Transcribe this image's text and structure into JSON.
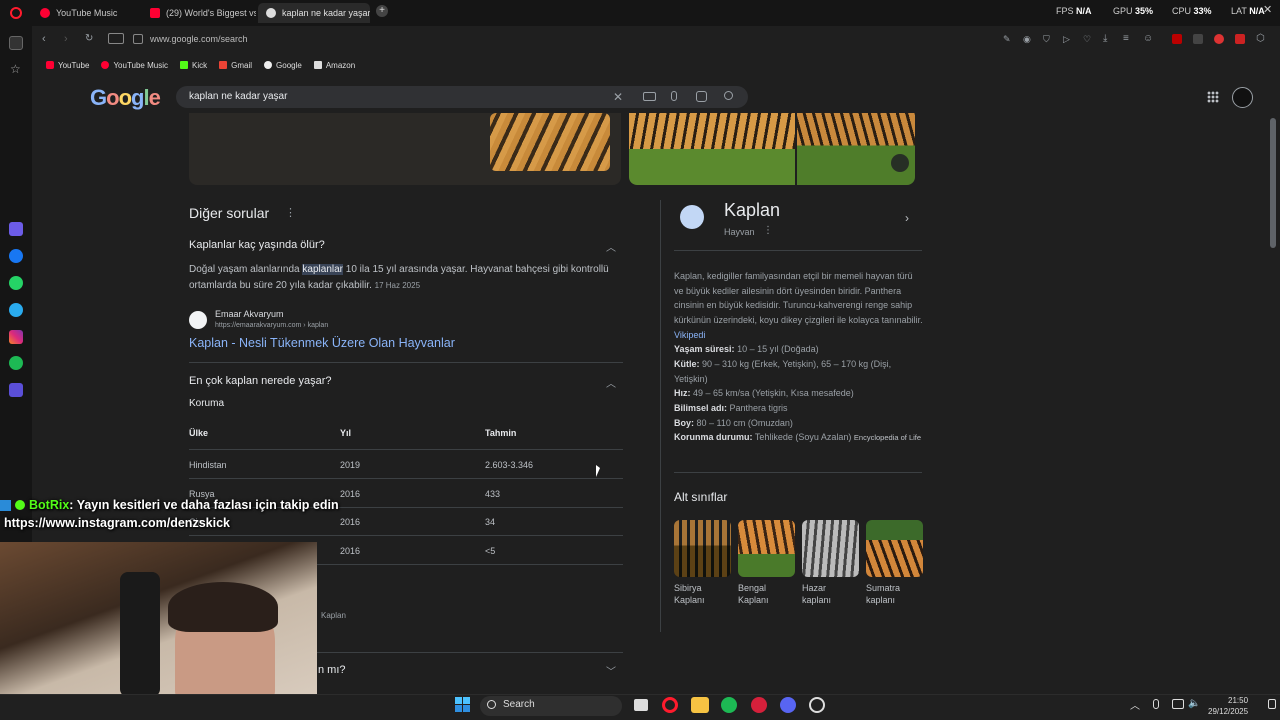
{
  "browser": {
    "tabs": [
      {
        "label": "YouTube Music"
      },
      {
        "label": "(29) World's Biggest vs Sm"
      },
      {
        "label": "kaplan ne kadar yaşar - Go"
      }
    ],
    "url": "www.google.com/search",
    "bookmarks": [
      "YouTube",
      "YouTube Music",
      "Kick",
      "Gmail",
      "Google",
      "Amazon"
    ],
    "stats": {
      "fps_label": "FPS",
      "fps_value": "N/A",
      "gpu_label": "GPU",
      "gpu_value": "35%",
      "cpu_label": "CPU",
      "cpu_value": "33%",
      "lat_label": "LAT",
      "lat_value": "N/A"
    }
  },
  "google": {
    "logo": "Google",
    "query": "kaplan ne kadar yaşar"
  },
  "paa": {
    "heading": "Diğer sorular",
    "q1": "Kaplanlar kaç yaşında ölür?",
    "a1_pre": "Doğal yaşam alanlarında ",
    "a1_hl": "kaplanlar",
    "a1_post": " 10 ila 15 yıl arasında yaşar. Hayvanat bahçesi gibi kontrollü ortamlarda bu süre 20 yıla kadar çıkabilir.",
    "a1_date": "17 Haz 2025",
    "source_name": "Emaar Akvaryum",
    "source_url": "https://emaarakvaryum.com › kaplan",
    "source_title": "Kaplan - Nesli Tükenmek Üzere Olan Hayvanlar",
    "q2": "En çok kaplan nerede yaşar?",
    "table_caption": "Koruma",
    "columns": [
      "Ülke",
      "Yıl",
      "Tahmin"
    ],
    "rows": [
      [
        "Hindistan",
        "2019",
        "2.603-3.346"
      ],
      [
        "Rusya",
        "2016",
        "433"
      ],
      [
        "Çin",
        "2016",
        "34"
      ],
      [
        "",
        "2016",
        "<5"
      ]
    ],
    "partial_source": "Kaplan",
    "q3_partial": "n mı?"
  },
  "knowledge": {
    "title": "Kaplan",
    "subtitle": "Hayvan",
    "description": "Kaplan, kedigiller familyasından etçil bir memeli hayvan türü ve büyük kediler ailesinin dört üyesinden biridir. Panthera cinsinin en büyük kedisidir. Turuncu-kahverengi renge sahip kürkünün üzerindeki, koyu dikey çizgileri ile kolayca tanınabilir.",
    "desc_link": "Vikipedi",
    "facts": [
      {
        "label": "Yaşam süresi:",
        "value": "10 – 15 yıl (Doğada)"
      },
      {
        "label": "Kütle:",
        "value": "90 – 310 kg (Erkek, Yetişkin), 65 – 170 kg (Dişi, Yetişkin)"
      },
      {
        "label": "Hız:",
        "value": "49 – 65 km/sa (Yetişkin, Kısa mesafede)"
      },
      {
        "label": "Bilimsel adı:",
        "value": "Panthera tigris"
      },
      {
        "label": "Boy:",
        "value": "80 – 110 cm (Omuzdan)"
      },
      {
        "label": "Korunma durumu:",
        "value": "Tehlikede (Soyu Azalan)",
        "extra": "Encyclopedia of Life"
      }
    ],
    "subclasses_heading": "Alt sınıflar",
    "subclasses": [
      {
        "line1": "Sibirya",
        "line2": "Kaplanı"
      },
      {
        "line1": "Bengal",
        "line2": "Kaplanı"
      },
      {
        "line1": "Hazar",
        "line2": "kaplanı"
      },
      {
        "line1": "Sumatra",
        "line2": "kaplanı"
      }
    ]
  },
  "stream": {
    "chat_user": "BotRix",
    "chat_message": ": Yayın kesitleri ve daha fazlası için takip edin",
    "chat_link": "https://www.instagram.com/denzskick"
  },
  "taskbar": {
    "search_label": "Search",
    "time": "21:50",
    "date": "29/12/2025"
  }
}
